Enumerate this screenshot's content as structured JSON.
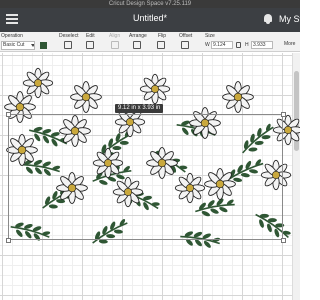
{
  "app": {
    "window_title": "Cricut Design Space  v7.25.119",
    "doc_title": "Untitled*",
    "user_label": "My Stu"
  },
  "toolbar": {
    "operation_label": "Operation",
    "operation_value": "Basic Cut",
    "deselect_label": "Deselect",
    "edit_label": "Edit",
    "align_label": "Align",
    "arrange_label": "Arrange",
    "flip_label": "Flip",
    "offset_label": "Offset",
    "size_label": "Size",
    "width_prefix": "W",
    "width_value": "9.124",
    "height_prefix": "H",
    "height_value": "3.933",
    "more_label": "More",
    "color": "#2f5634"
  },
  "canvas": {
    "selection_size": "9.12  in x 3.93  in"
  },
  "colors": {
    "petal": "#f2f2f2",
    "center": "#c9a83c",
    "leaf": "#2f5634",
    "header": "#3c3f43"
  },
  "icons": {
    "menu": "hamburger-icon",
    "notifications": "bell-icon",
    "lock": "lock-icon"
  }
}
